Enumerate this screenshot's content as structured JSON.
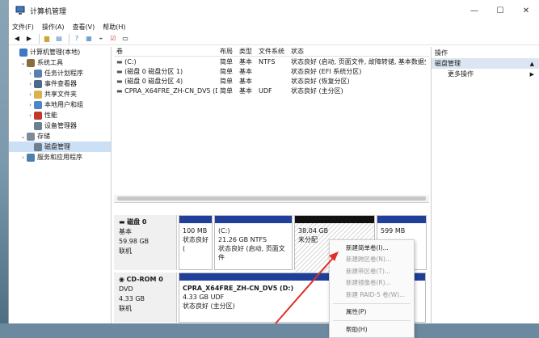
{
  "window": {
    "title": "计算机管理",
    "controls": {
      "minimize": "—",
      "maximize": "☐",
      "close": "✕"
    }
  },
  "menu": [
    "文件(F)",
    "操作(A)",
    "查看(V)",
    "帮助(H)"
  ],
  "tree": [
    {
      "label": "计算机管理(本地)",
      "chev": "",
      "indent": 0,
      "icon": "computer-icon"
    },
    {
      "label": "系统工具",
      "chev": "⌄",
      "indent": 1,
      "icon": "tools-icon"
    },
    {
      "label": "任务计划程序",
      "chev": "›",
      "indent": 2,
      "icon": "clock-icon"
    },
    {
      "label": "事件查看器",
      "chev": "›",
      "indent": 2,
      "icon": "event-viewer-icon"
    },
    {
      "label": "共享文件夹",
      "chev": "›",
      "indent": 2,
      "icon": "folder-icon"
    },
    {
      "label": "本地用户和组",
      "chev": "›",
      "indent": 2,
      "icon": "users-icon"
    },
    {
      "label": "性能",
      "chev": "›",
      "indent": 2,
      "icon": "performance-icon"
    },
    {
      "label": "设备管理器",
      "chev": "",
      "indent": 2,
      "icon": "device-manager-icon"
    },
    {
      "label": "存储",
      "chev": "⌄",
      "indent": 1,
      "icon": "storage-icon"
    },
    {
      "label": "磁盘管理",
      "chev": "",
      "indent": 2,
      "icon": "disk-management-icon",
      "selected": true
    },
    {
      "label": "服务和应用程序",
      "chev": "›",
      "indent": 1,
      "icon": "services-icon"
    }
  ],
  "volumes": {
    "headers": [
      "卷",
      "布局",
      "类型",
      "文件系统",
      "状态"
    ],
    "rows": [
      [
        "(C:)",
        "简单",
        "基本",
        "NTFS",
        "状态良好 (启动, 页面文件, 故障转储, 基本数据分"
      ],
      [
        "(磁盘 0 磁盘分区 1)",
        "简单",
        "基本",
        "",
        "状态良好 (EFI 系统分区)"
      ],
      [
        "(磁盘 0 磁盘分区 4)",
        "简单",
        "基本",
        "",
        "状态良好 (恢复分区)"
      ],
      [
        "CPRA_X64FRE_ZH-CN_DV5 (D:)",
        "简单",
        "基本",
        "UDF",
        "状态良好 (主分区)"
      ]
    ]
  },
  "disk0": {
    "name": "磁盘 0",
    "type": "基本",
    "size": "59.98 GB",
    "status": "联机",
    "parts": [
      {
        "line1": "100 MB",
        "line2": "状态良好 (",
        "line0": ""
      },
      {
        "line0": "(C:)",
        "line1": "21.26 GB NTFS",
        "line2": "状态良好 (启动, 页面文件"
      },
      {
        "line0": "",
        "line1": "38.04 GB",
        "line2": "未分配"
      },
      {
        "line0": "",
        "line1": "599 MB",
        "line2": ""
      }
    ]
  },
  "cdrom": {
    "name": "CD-ROM 0",
    "type": "DVD",
    "size": "4.33 GB",
    "status": "联机",
    "part": {
      "line0": "CPRA_X64FRE_ZH-CN_DV5 (D:)",
      "line1": "4.33 GB UDF",
      "line2": "状态良好 (主分区)"
    }
  },
  "actions": {
    "header": "操作",
    "section": "磁盘管理",
    "more": "更多操作",
    "arrow": "▲",
    "more_arrow": "▶"
  },
  "context_menu": [
    {
      "label": "新建简单卷(I)...",
      "enabled": true
    },
    {
      "label": "新建跨区卷(N)...",
      "enabled": false
    },
    {
      "label": "新建带区卷(T)...",
      "enabled": false
    },
    {
      "label": "新建镜像卷(R)...",
      "enabled": false
    },
    {
      "label": "新建 RAID-5 卷(W)...",
      "enabled": false
    },
    {
      "sep": true
    },
    {
      "label": "属性(P)",
      "enabled": true
    },
    {
      "sep": true
    },
    {
      "label": "帮助(H)",
      "enabled": true
    }
  ],
  "colors": {
    "primary_partition": "#1f3f9a",
    "unallocated": "#111111",
    "arrow": "#e0302a",
    "selection": "#cce0f5"
  }
}
